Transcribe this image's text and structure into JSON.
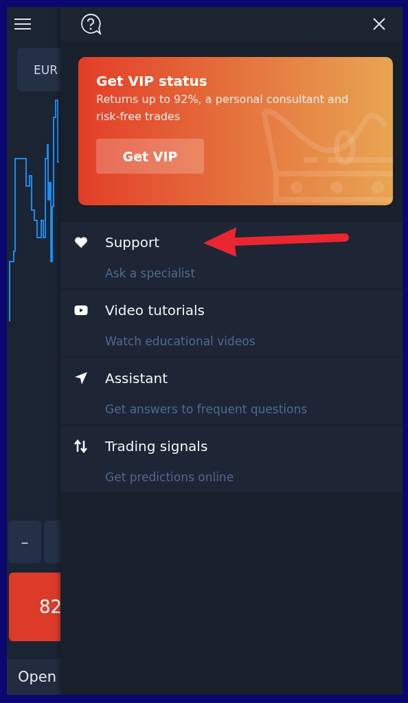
{
  "background_app": {
    "asset_button": "EUR",
    "minus_button": "–",
    "buy_button": "82",
    "open_label": "Open"
  },
  "panel": {
    "vip_card": {
      "title": "Get VIP status",
      "text": "Returns up to 92%, a personal consultant and risk-free trades",
      "button": "Get VIP"
    },
    "items": [
      {
        "title": "Support",
        "subtitle": "Ask a specialist"
      },
      {
        "title": "Video tutorials",
        "subtitle": "Watch educational videos"
      },
      {
        "title": "Assistant",
        "subtitle": "Get answers to frequent questions"
      },
      {
        "title": "Trading signals",
        "subtitle": "Get predictions online"
      }
    ]
  }
}
